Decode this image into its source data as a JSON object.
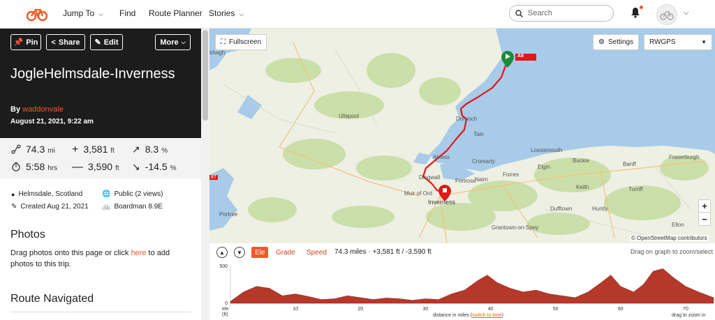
{
  "nav": {
    "items": [
      {
        "label": "Jump To",
        "caret": true
      },
      {
        "label": "Find",
        "caret": false
      },
      {
        "label": "Route Planner",
        "caret": false
      },
      {
        "label": "Stories",
        "caret": true
      }
    ],
    "search_placeholder": "Search"
  },
  "hero": {
    "pin_label": "Pin",
    "share_label": "Share",
    "edit_label": "Edit",
    "more_label": "More",
    "title": "JogleHelmsdale-Inverness",
    "by_prefix": "By",
    "author": "waddonvale",
    "date": "August 21, 2021, 9:22 am"
  },
  "stats": {
    "distance": {
      "value": "74.3",
      "unit": "mi"
    },
    "elev_gain": {
      "value": "3,581",
      "unit": "ft"
    },
    "grade_up": {
      "value": "8.3",
      "unit": "%"
    },
    "duration": {
      "value": "5:58",
      "unit": "hrs"
    },
    "elev_loss": {
      "value": "3,590",
      "unit": "ft"
    },
    "grade_down": {
      "value": "-14.5",
      "unit": "%"
    }
  },
  "meta": {
    "location": "Helmsdale, Scotland",
    "visibility": "Public (2 views)",
    "created": "Created Aug 21, 2021",
    "bike": "Boardman 8.9E"
  },
  "photos": {
    "heading": "Photos",
    "text_before": "Drag photos onto this page or click",
    "link": "here",
    "text_after": "to add photos to this trip."
  },
  "route_navigated": {
    "heading": "Route Navigated"
  },
  "map": {
    "fullscreen_label": "Fullscreen",
    "settings_label": "Settings",
    "layer_select": "RWGPS",
    "zoom_in": "+",
    "zoom_out": "−",
    "attribution": "© OpenStreetMap contributors",
    "road_label": "A9",
    "places": [
      "Ullapool",
      "Dornoch",
      "Tain",
      "Alness",
      "Cromarty",
      "Dingwall",
      "Fortrose",
      "Nairn",
      "Inverness",
      "Muir of Ord",
      "Lossiemouth",
      "Forres",
      "Elgin",
      "Buckie",
      "Banff",
      "Fraserburgh",
      "Keith",
      "Turriff",
      "Dufftown",
      "Huntly",
      "Grantown-on-Spey",
      "Ellon",
      "Portree",
      "bhagh"
    ],
    "side_label": "87"
  },
  "elevation": {
    "tabs": [
      "Ele",
      "Grade",
      "Speed"
    ],
    "active_tab": "Ele",
    "summary": "74.3 miles · +3,581 ft / -3,590 ft",
    "hint": "Drag on graph to zoom/select",
    "y_ticks": [
      "500",
      "0"
    ],
    "x_ticks": [
      "10",
      "20",
      "30",
      "40",
      "50",
      "60",
      "70"
    ],
    "y_unit_label": "ele",
    "y_unit": "(ft)",
    "x_label": "distance in miles",
    "switch_label": "switch to time",
    "zoom_hint": "drag to zoom in"
  },
  "colors": {
    "brand": "#f05a28",
    "route": "#e01818",
    "profile": "#b5382a"
  }
}
